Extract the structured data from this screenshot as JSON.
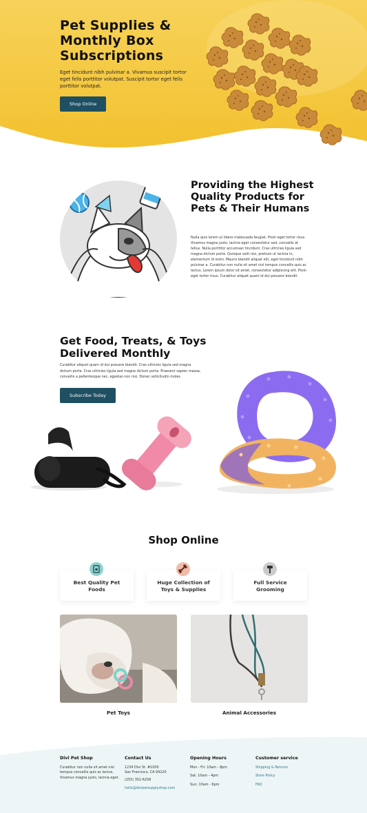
{
  "hero": {
    "title": "Pet Supplies & Monthly Box Subscriptions",
    "text": "Eget tincidunt nibh pulvinar a. Vivamus suscipit tortor eget felis porttitor volutpat. Suscipit tortor eget felis porttitor volutpat.",
    "button": "Shop Online"
  },
  "quality": {
    "title": "Providing the Highest Quality Products for Pets & Their Humans",
    "text": "Nulla quis lorem ut libero malesuada feugiat. Proin eget tortor risus. Vivamus magna justo, lacinia eget consectetur sed, convallis at tellus. Nulla porttitor accumsan tincidunt. Cras ultricies ligula sed magna dictum porta. Quisque velit nisi, pretium ut lacinia in, elementum id enim. Mauris blandit aliquet elit, eget tincidunt nibh pulvinar a. Curabitur non nulla sit amet nisl tempus convallis quis ac lectus. Lorem ipsum dolor sit amet, consectetur adipiscing elit. Proin eget tortor risus. Curabitur aliquet quam id dui posuere blandit."
  },
  "monthly": {
    "title": "Get Food, Treats, & Toys Delivered Monthly",
    "text": "Curabitur aliquet quam id dui posuere blandit. Cras ultricies ligula sed magna dictum porta. Cras ultricies ligula sed magna dictum porta. Praesent sapien massa, convallis a pellentesque nec, egestas non nisi. Donec sollicitudin moles",
    "button": "Subscribe Today"
  },
  "shop": {
    "title": "Shop Online",
    "features": [
      {
        "label": "Best Quality Pet Foods",
        "icon": "food-bag-icon",
        "color": "#8fd0cc"
      },
      {
        "label": "Huge Collection of Toys & Supplies",
        "icon": "bone-toy-icon",
        "color": "#f2b9a7"
      },
      {
        "label": "Full Service Grooming",
        "icon": "grooming-brush-icon",
        "color": "#c9cdc9"
      }
    ],
    "products": [
      {
        "label": "Pet Toys"
      },
      {
        "label": "Animal Accessories"
      }
    ]
  },
  "footer": {
    "shop": {
      "heading": "Divi Pet Shop",
      "text": "Curabitur non nulla sit amet nisl tempus convallis quis ac lectus. Vivamus magna justo, lacinia eget."
    },
    "contact": {
      "heading": "Contact Us",
      "address1": "1234 Divi St. #1000",
      "address2": "San Francisco, CA 94220",
      "phone": "(255) 352-6258",
      "email": "hello@divipetsupplyshop.com"
    },
    "hours": {
      "heading": "Opening Hours",
      "weekdays": "Mon - Fri: 10am - 8pm",
      "saturday": "Sat: 10am - 4pm",
      "sunday": "Sun: 10am - 6pm"
    },
    "service": {
      "heading": "Customer service",
      "links": [
        "Shipping & Returns",
        "Store Policy",
        "FAQ"
      ]
    }
  },
  "colors": {
    "accent_yellow": "#f5c53d",
    "button": "#1f4f63",
    "link": "#2a7a8a",
    "footer_bg": "#eef5f6"
  }
}
